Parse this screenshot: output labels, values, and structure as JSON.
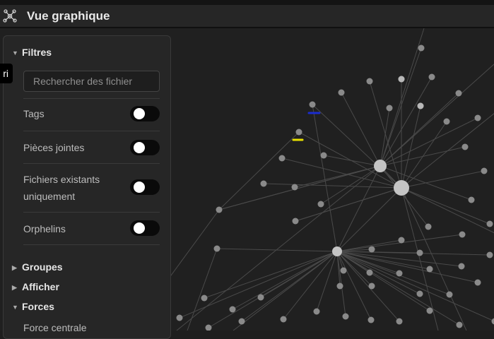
{
  "header": {
    "title": "Vue graphique",
    "icon": "graph-icon"
  },
  "tooltip": {
    "text": "ri"
  },
  "panel": {
    "filters_title": "Filtres",
    "search_placeholder": "Rechercher des fichier",
    "toggles": [
      {
        "label": "Tags",
        "on": false
      },
      {
        "label": "Pièces jointes",
        "on": false
      },
      {
        "label": "Fichiers existants uniquement",
        "on": false
      },
      {
        "label": "Orphelins",
        "on": false
      }
    ],
    "groups_title": "Groupes",
    "display_title": "Afficher",
    "forces_title": "Forces",
    "forces_first_item": "Force centrale"
  },
  "graph": {
    "background": "#202020",
    "node_color": "#8a8a8a",
    "link_color": "#4a4a4a",
    "highlight_colors": {
      "yellow": "#e8e000",
      "blue": "#1a2ccf"
    }
  }
}
